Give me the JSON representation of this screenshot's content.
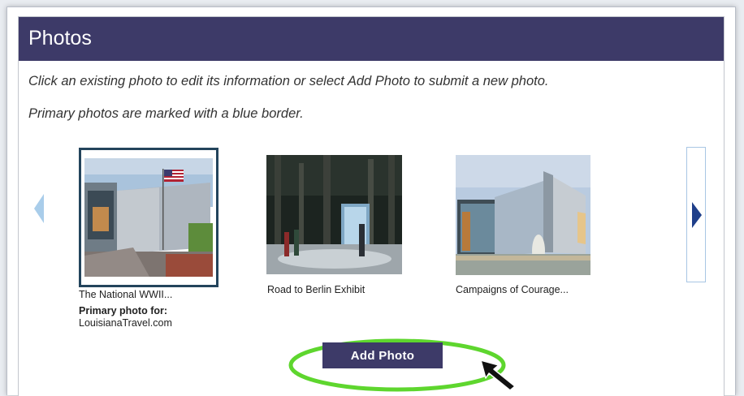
{
  "panel": {
    "title": "Photos",
    "instruction_1": "Click an existing photo to edit its information or select Add Photo to submit a new photo.",
    "instruction_2": "Primary photos are marked with a blue border."
  },
  "carousel": {
    "photos": [
      {
        "caption": "The National WWII...",
        "is_primary": true,
        "primary_label": "Primary photo for:",
        "primary_site": "LouisianaTravel.com"
      },
      {
        "caption": "Road to Berlin Exhibit",
        "is_primary": false
      },
      {
        "caption": "Campaigns of Courage...",
        "is_primary": false
      }
    ],
    "prev_icon": "chevron-left-icon",
    "next_icon": "chevron-right-icon"
  },
  "actions": {
    "add_photo_label": "Add Photo"
  },
  "colors": {
    "header_bg": "#3d3a68",
    "primary_border": "#23445c",
    "highlight_ring": "#5ed62e",
    "arrow_active": "#1f3f8a",
    "arrow_disabled": "#a9cdea"
  }
}
